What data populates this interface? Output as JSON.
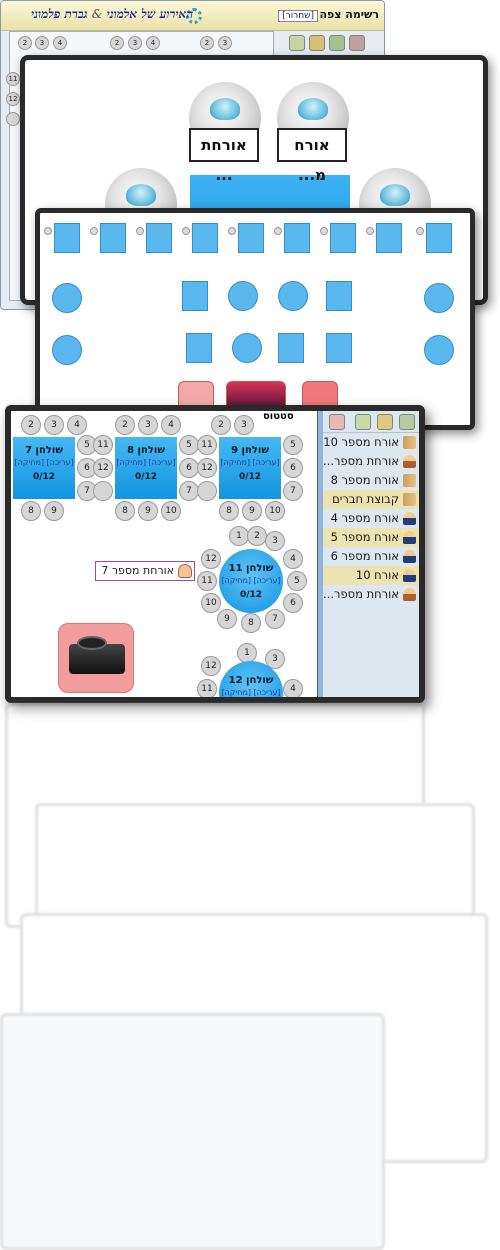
{
  "app": {
    "title_part1": "גברת פלמוני",
    "title_amp": "&",
    "title_part2": "האירוע של אלמוני",
    "tab_label": "רשימה צפה",
    "tab_pill": "[שחרור]"
  },
  "popup": {
    "chair_labels": [
      "אורח מ...",
      "אורחת ..."
    ]
  },
  "main": {
    "status_label": "סטטוס",
    "seat_numbers": [
      "1",
      "2",
      "3",
      "4",
      "5",
      "6",
      "7",
      "8",
      "9",
      "10",
      "11",
      "12"
    ],
    "tables": [
      {
        "name": "שולחן 7",
        "tags": "[עריכה] [מחיקה]",
        "count": "0/12"
      },
      {
        "name": "שולחן 8",
        "tags": "[עריכה] [מחיקה]",
        "count": "0/12"
      },
      {
        "name": "שולחן 9",
        "tags": "[עריכה] [מחיקה]",
        "count": "0/12"
      },
      {
        "name": "שולחן 11",
        "tags": "[עריכה] [מחיקה]",
        "count": "0/12"
      },
      {
        "name": "שולחן 12",
        "tags": "[עריכה] [מחיקה]",
        "count": ""
      }
    ],
    "floating_guest": "אורחת מספר 7",
    "sidebar_items": [
      {
        "label": "אורח מספר 10",
        "icon": "group-icon",
        "highlight": false
      },
      {
        "label": "אורחת מספר...",
        "icon": "female-icon",
        "highlight": false
      },
      {
        "label": "אורח מספר 8",
        "icon": "group-icon",
        "highlight": false
      },
      {
        "label": "קבוצת חברים",
        "icon": "group-icon",
        "highlight": true
      },
      {
        "label": "אורח מספר 4",
        "icon": "male-icon",
        "highlight": false
      },
      {
        "label": "אורח מספר 5",
        "icon": "male-icon",
        "highlight": true
      },
      {
        "label": "אורח מספר 6",
        "icon": "male-icon",
        "highlight": false
      },
      {
        "label": "אורח 10",
        "icon": "male-icon",
        "highlight": true
      },
      {
        "label": "אורחת מספר...",
        "icon": "female-icon",
        "highlight": false
      }
    ]
  },
  "colors": {
    "table_blue": "#1295e0",
    "sidebar_bg": "#dde7ef",
    "highlight": "#ece3b0",
    "title_blue": "#1d2e8e"
  }
}
